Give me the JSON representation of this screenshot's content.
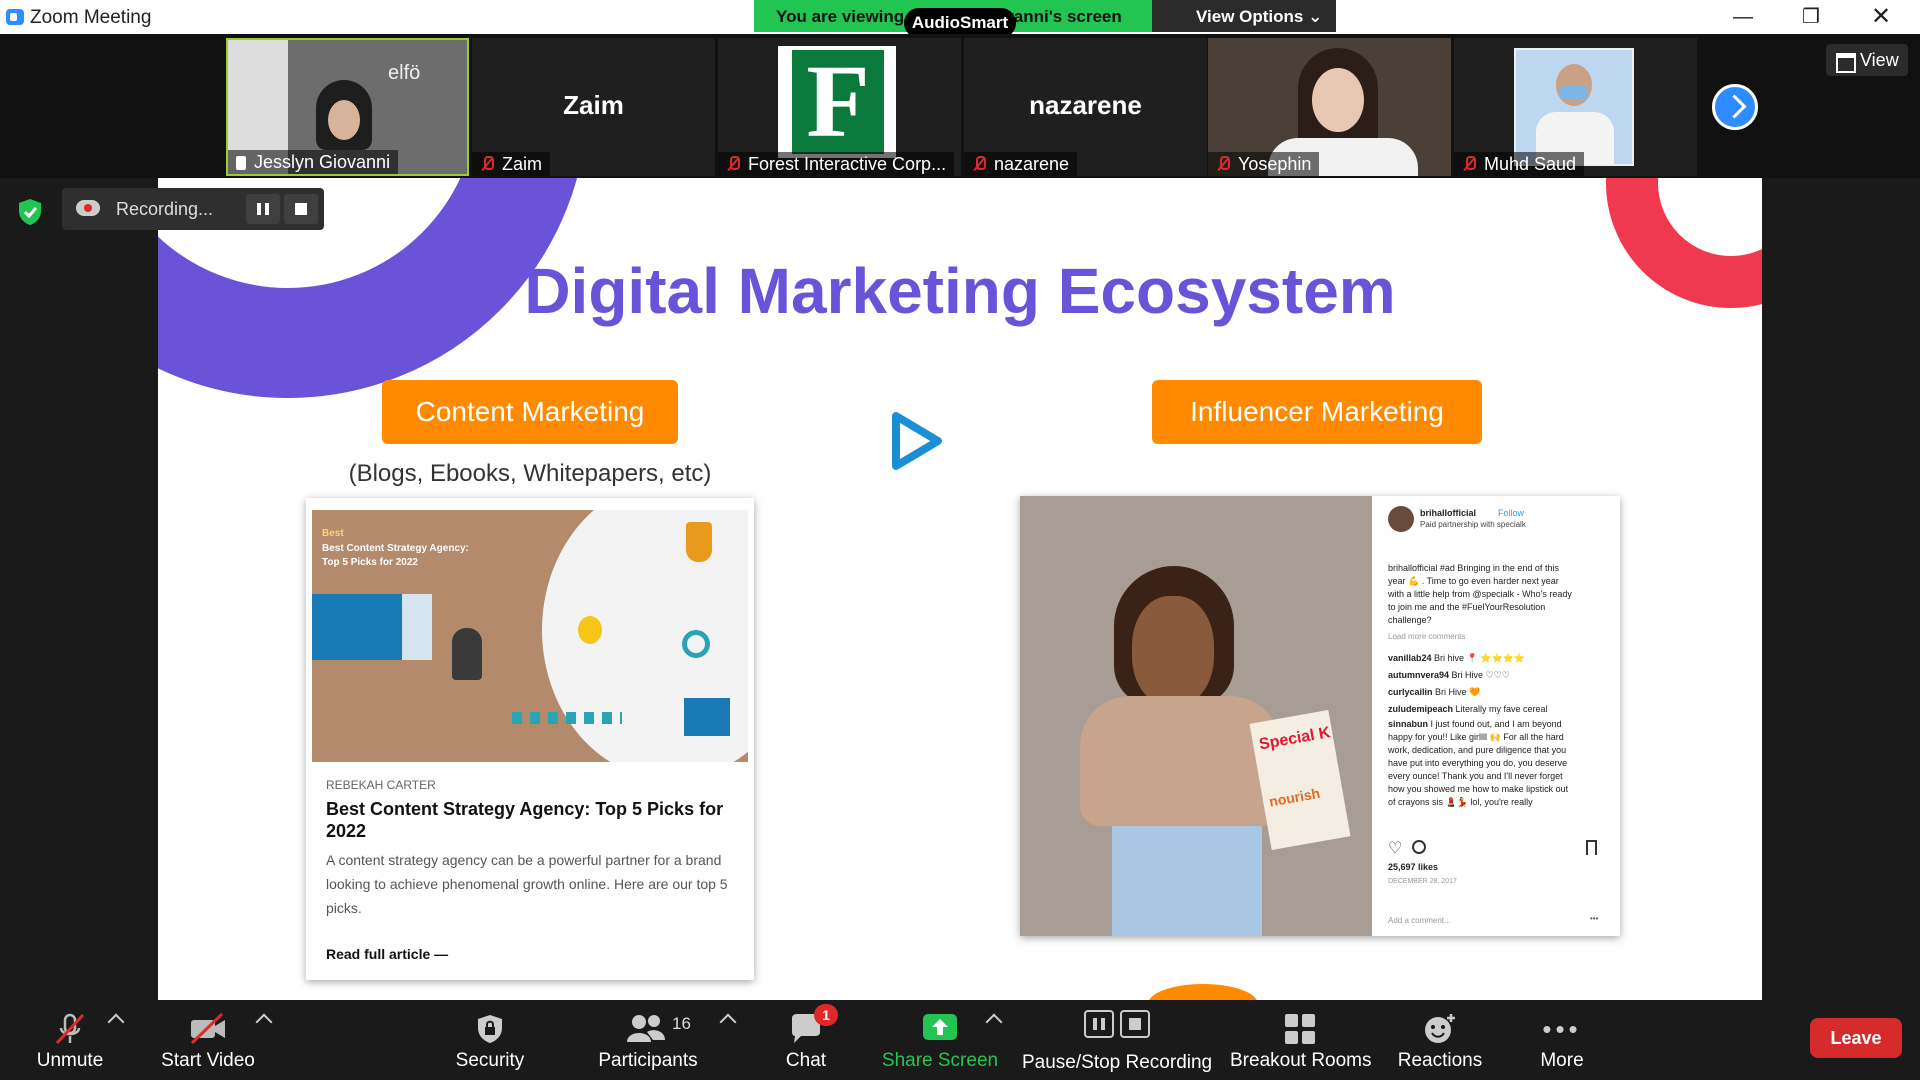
{
  "window": {
    "title": "Zoom Meeting"
  },
  "banner": {
    "viewing_text": "You are viewing Jesslyn Giovanni's screen",
    "audiosmart_badge": "AudioSmart",
    "view_options_label": "View Options ⌄"
  },
  "participants": [
    {
      "name": "Jesslyn Giovanni",
      "display": "video",
      "watermark": "elfö"
    },
    {
      "name": "Zaim",
      "display": "name-card",
      "card_text": "Zaim"
    },
    {
      "name": "Forest Interactive Corp...",
      "display": "logo",
      "logo_letter": "F"
    },
    {
      "name": "nazarene",
      "display": "name-card",
      "card_text": "nazarene"
    },
    {
      "name": "Yosephin",
      "display": "video"
    },
    {
      "name": "Muhd Saud",
      "display": "photo"
    }
  ],
  "strip": {
    "view_label": "View"
  },
  "recording": {
    "label": "Recording..."
  },
  "slide": {
    "title": "Digital Marketing Ecosystem",
    "left_heading": "Content Marketing",
    "left_subheading": "(Blogs, Ebooks, Whitepapers, etc)",
    "right_heading": "Influencer Marketing",
    "article": {
      "image_caption": "Best Content Strategy Agency: Top 5 Picks for 2022",
      "image_tag": "Best",
      "author": "REBEKAH CARTER",
      "title": "Best Content Strategy Agency: Top 5 Picks for 2022",
      "excerpt": "A content strategy agency can be a powerful partner for a brand looking to achieve phenomenal growth online. Here are our top 5 picks.",
      "link": "Read full article —"
    },
    "instagram": {
      "handle": "brihallofficial",
      "follow": "Follow",
      "partnership": "Paid partnership with specialk",
      "caption": "brihallofficial #ad Bringing in the end of this year 💪 . Time to go even harder next year with a little help from @specialk - Who's ready to join me and the #FuelYourResolution challenge?",
      "load_more": "Load more comments",
      "comments": [
        {
          "user": "vanillab24",
          "text": "Bri hive 📍 ⭐⭐⭐⭐"
        },
        {
          "user": "autumnvera94",
          "text": "Bri Hive ♡♡♡"
        },
        {
          "user": "curlycailin",
          "text": "Bri Hive 🧡"
        },
        {
          "user": "zuludemipeach",
          "text": "Literally my fave cereal"
        },
        {
          "user": "sinnabun",
          "text": "I just found out, and I am beyond happy for you!! Like girllll 🙌 For all the hard work, dedication, and pure diligence that you have put into everything you do, you deserve every ounce! Thank you and I'll never forget how you showed me how to make lipstick out of crayons sis 💄💃 lol, you're really"
        }
      ],
      "likes": "25,697 likes",
      "date": "DECEMBER 28, 2017",
      "add_comment": "Add a comment...",
      "more": "•••",
      "box_text_1": "Special K",
      "box_text_2": "nourish"
    }
  },
  "toolbar": {
    "unmute": "Unmute",
    "start_video": "Start Video",
    "security": "Security",
    "participants": "Participants",
    "participants_count": "16",
    "chat": "Chat",
    "chat_badge": "1",
    "share_screen": "Share Screen",
    "recording": "Pause/Stop Recording",
    "breakout": "Breakout Rooms",
    "reactions": "Reactions",
    "more": "More",
    "leave": "Leave"
  },
  "colors": {
    "zoom_blue": "#2d8cff",
    "banner_green": "#23c552",
    "slide_purple": "#6a53d9",
    "slide_orange": "#ff8a00",
    "slide_coral": "#f0394e",
    "leave_red": "#d52b2b"
  }
}
